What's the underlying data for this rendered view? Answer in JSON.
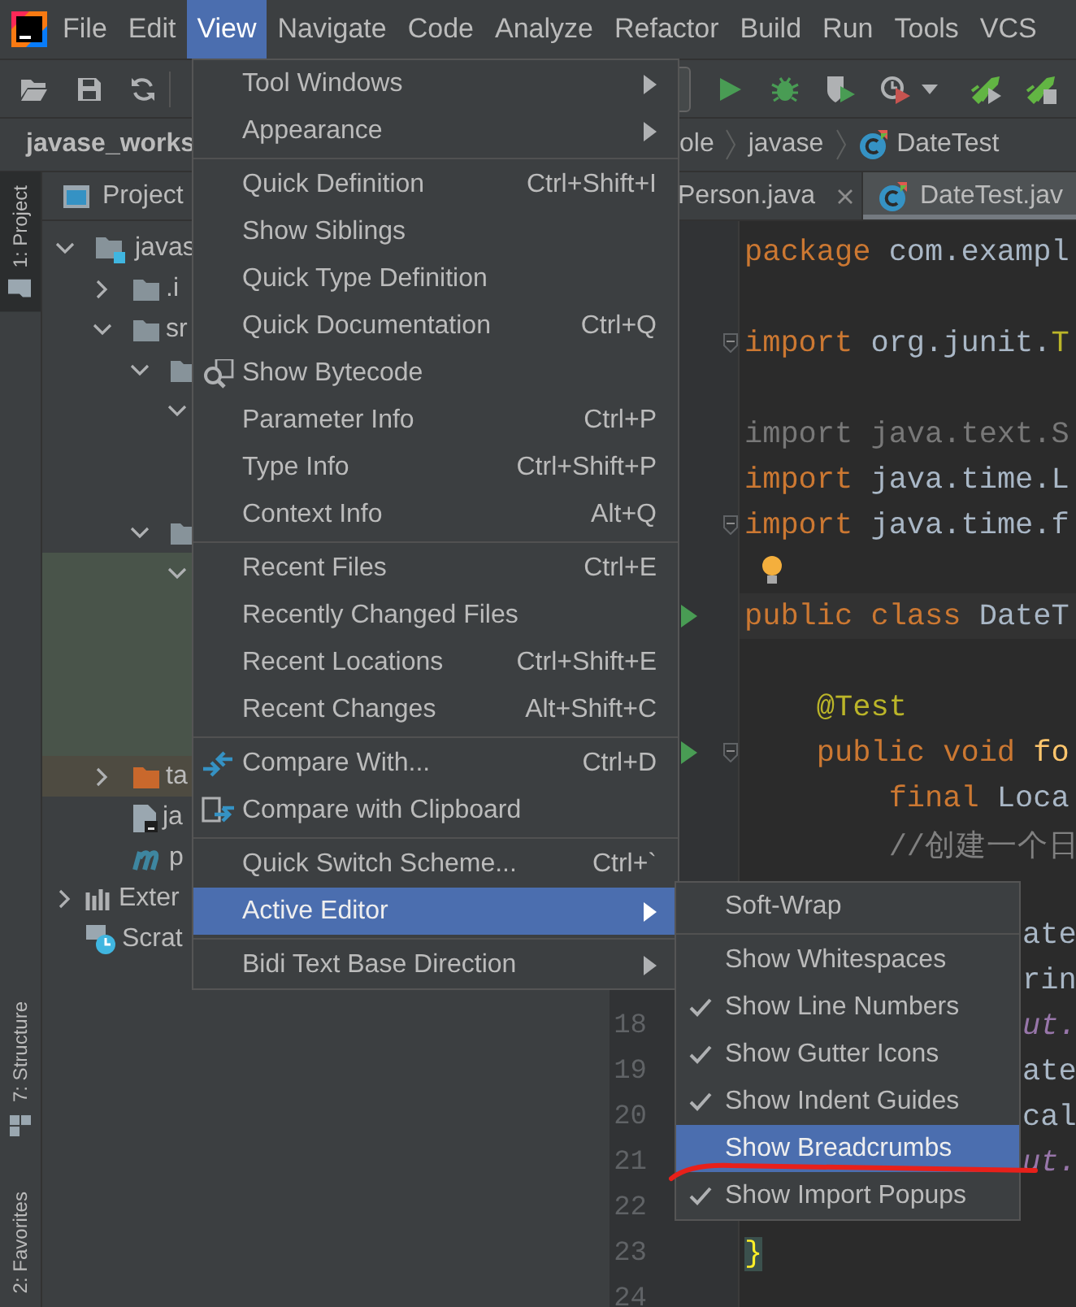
{
  "menu_bar": {
    "items": [
      {
        "label": "File",
        "selected": false
      },
      {
        "label": "Edit",
        "selected": false
      },
      {
        "label": "View",
        "selected": true
      },
      {
        "label": "Navigate",
        "selected": false
      },
      {
        "label": "Code",
        "selected": false
      },
      {
        "label": "Analyze",
        "selected": false
      },
      {
        "label": "Refactor",
        "selected": false
      },
      {
        "label": "Build",
        "selected": false
      },
      {
        "label": "Run",
        "selected": false
      },
      {
        "label": "Tools",
        "selected": false
      },
      {
        "label": "VCS",
        "selected": false
      }
    ]
  },
  "breadcrumbs": [
    {
      "label": "javase_works",
      "kind": "project"
    },
    {
      "label": "ole",
      "kind": "folder"
    },
    {
      "label": "javase",
      "kind": "folder"
    },
    {
      "label": "DateTest",
      "kind": "class"
    }
  ],
  "tool_window_tabs": [
    {
      "label": "1: Project",
      "kind": "project",
      "selected": true
    },
    {
      "label": "7: Structure",
      "kind": "structure",
      "selected": false
    },
    {
      "label": "2: Favorites",
      "kind": "favorites",
      "selected": false
    }
  ],
  "project_panel": {
    "title": "Project",
    "tree": [
      {
        "label": "javas",
        "kind": "module",
        "expanded": true,
        "children": [
          {
            "label": ".i",
            "kind": "folder",
            "expanded": false
          },
          {
            "label": "sr",
            "kind": "folder",
            "expanded": true,
            "children": [
              {
                "kind": "folder",
                "expanded": true,
                "children": [
                  {
                    "expanded": true
                  }
                ]
              },
              {
                "kind": "folder",
                "expanded": true,
                "children": [
                  {
                    "expanded": true,
                    "color": "#49544a",
                    "children": [
                      {
                        "color": "#49544a"
                      },
                      {
                        "color": "#49544a"
                      },
                      {
                        "color": "#49544a"
                      },
                      {
                        "color": "#49544a"
                      }
                    ]
                  }
                ]
              }
            ]
          },
          {
            "label": "ta",
            "kind": "excluded",
            "expanded": false,
            "color": "#4e4b41"
          },
          {
            "label": "ja",
            "kind": "file"
          },
          {
            "label": "p",
            "kind": "m"
          }
        ]
      },
      {
        "label": "Exter",
        "kind": "library",
        "expanded": false
      },
      {
        "label": "Scrat",
        "kind": "scratch"
      }
    ]
  },
  "editor": {
    "tabs": [
      {
        "label": "Person.java",
        "selected": false,
        "closable": true
      },
      {
        "label": "DateTest.jav",
        "selected": true
      }
    ],
    "lines": [
      {
        "kind": "code",
        "tokens": [
          {
            "text": "package",
            "kind": "keyword"
          },
          {
            "text": " com.exampl",
            "kind": "plain"
          }
        ]
      },
      {
        "kind": "code"
      },
      {
        "kind": "code",
        "fold": true,
        "tokens": [
          {
            "text": "import",
            "kind": "keyword"
          },
          {
            "text": " org.junit.",
            "kind": "plain"
          },
          {
            "text": "T",
            "kind": "annotation"
          }
        ]
      },
      {
        "kind": "code"
      },
      {
        "kind": "code",
        "tokens": [
          {
            "text": "import java.text.S",
            "kind": "unused"
          }
        ]
      },
      {
        "kind": "code",
        "tokens": [
          {
            "text": "import",
            "kind": "keyword"
          },
          {
            "text": " java.time.L",
            "kind": "plain"
          }
        ]
      },
      {
        "kind": "code",
        "fold": true,
        "tokens": [
          {
            "text": "import",
            "kind": "keyword"
          },
          {
            "text": " java.time.f",
            "kind": "plain"
          }
        ]
      },
      {
        "kind": "code",
        "intention": true
      },
      {
        "kind": "code",
        "run": true,
        "current": true,
        "tokens": [
          {
            "text": "public class",
            "kind": "keyword"
          },
          {
            "text": " DateT",
            "kind": "plain"
          }
        ]
      },
      {
        "kind": "code"
      },
      {
        "kind": "code",
        "tokens": [
          {
            "text": "    @Test",
            "kind": "annotation"
          }
        ]
      },
      {
        "kind": "code",
        "run": true,
        "fold": true,
        "tokens": [
          {
            "text": "    public void",
            "kind": "keyword"
          },
          {
            "text": " fo",
            "kind": "method"
          }
        ]
      },
      {
        "kind": "code",
        "tokens": [
          {
            "text": "        final",
            "kind": "keyword"
          },
          {
            "text": " Loca",
            "kind": "plain"
          }
        ]
      },
      {
        "kind": "code",
        "tokens": [
          {
            "text": "        //创建一个日",
            "kind": "comment"
          }
        ]
      },
      {
        "kind": "code"
      },
      {
        "kind": "tail",
        "tokens": [
          {
            "text": "ate",
            "kind": "plain"
          }
        ]
      },
      {
        "kind": "tail",
        "tokens": [
          {
            "text": "rin",
            "kind": "plain"
          }
        ]
      },
      {
        "kind": "tail",
        "number": "18",
        "tokens": [
          {
            "text": "ut.",
            "kind": "field"
          }
        ]
      },
      {
        "kind": "tail",
        "number": "19",
        "tokens": [
          {
            "text": "ate",
            "kind": "plain"
          }
        ]
      },
      {
        "kind": "tail",
        "number": "20",
        "tokens": [
          {
            "text": "cal",
            "kind": "plain"
          }
        ]
      },
      {
        "kind": "tail",
        "number": "21",
        "tokens": [
          {
            "text": "ut.",
            "kind": "field"
          }
        ]
      },
      {
        "kind": "code",
        "number": "22"
      },
      {
        "kind": "code",
        "number": "23",
        "tokens": [
          {
            "text": "}",
            "kind": "brace"
          }
        ]
      },
      {
        "kind": "code",
        "number": "24"
      }
    ]
  },
  "view_menu": {
    "groups": [
      [
        {
          "label": "Tool Windows",
          "kind": "submenu",
          "selected": false
        },
        {
          "label": "Appearance",
          "kind": "submenu",
          "selected": false
        }
      ],
      [
        {
          "label": "Quick Definition",
          "shortcut": "Ctrl+Shift+I",
          "kind": "item",
          "selected": false
        },
        {
          "label": "Show Siblings",
          "kind": "item",
          "selected": false
        },
        {
          "label": "Quick Type Definition",
          "kind": "item",
          "selected": false
        },
        {
          "label": "Quick Documentation",
          "shortcut": "Ctrl+Q",
          "kind": "item",
          "selected": false
        },
        {
          "label": "Show Bytecode",
          "kind": "bytecode",
          "selected": false
        },
        {
          "label": "Parameter Info",
          "shortcut": "Ctrl+P",
          "kind": "item",
          "selected": false
        },
        {
          "label": "Type Info",
          "shortcut": "Ctrl+Shift+P",
          "kind": "item",
          "selected": false
        },
        {
          "label": "Context Info",
          "shortcut": "Alt+Q",
          "kind": "item",
          "selected": false
        }
      ],
      [
        {
          "label": "Recent Files",
          "shortcut": "Ctrl+E",
          "kind": "item",
          "selected": false
        },
        {
          "label": "Recently Changed Files",
          "kind": "item",
          "selected": false
        },
        {
          "label": "Recent Locations",
          "shortcut": "Ctrl+Shift+E",
          "kind": "item",
          "selected": false
        },
        {
          "label": "Recent Changes",
          "shortcut": "Alt+Shift+C",
          "kind": "item",
          "selected": false
        }
      ],
      [
        {
          "label": "Compare With...",
          "shortcut": "Ctrl+D",
          "kind": "compare",
          "selected": false
        },
        {
          "label": "Compare with Clipboard",
          "kind": "clipboard",
          "selected": false
        }
      ],
      [
        {
          "label": "Quick Switch Scheme...",
          "shortcut": "Ctrl+`",
          "kind": "item",
          "selected": false
        },
        {
          "label": "Active Editor",
          "kind": "submenu",
          "selected": true
        }
      ],
      [
        {
          "label": "Bidi Text Base Direction",
          "kind": "submenu",
          "selected": false
        }
      ]
    ]
  },
  "active_editor_menu": {
    "groups": [
      [
        {
          "label": "Soft-Wrap",
          "checked": false,
          "selected": false
        }
      ],
      [
        {
          "label": "Show Whitespaces",
          "checked": false,
          "selected": false
        },
        {
          "label": "Show Line Numbers",
          "checked": true,
          "selected": false
        },
        {
          "label": "Show Gutter Icons",
          "checked": true,
          "selected": false
        },
        {
          "label": "Show Indent Guides",
          "checked": true,
          "selected": false
        },
        {
          "label": "Show Breadcrumbs",
          "checked": false,
          "selected": true
        },
        {
          "label": "Show Import Popups",
          "checked": true,
          "selected": false
        }
      ]
    ]
  }
}
